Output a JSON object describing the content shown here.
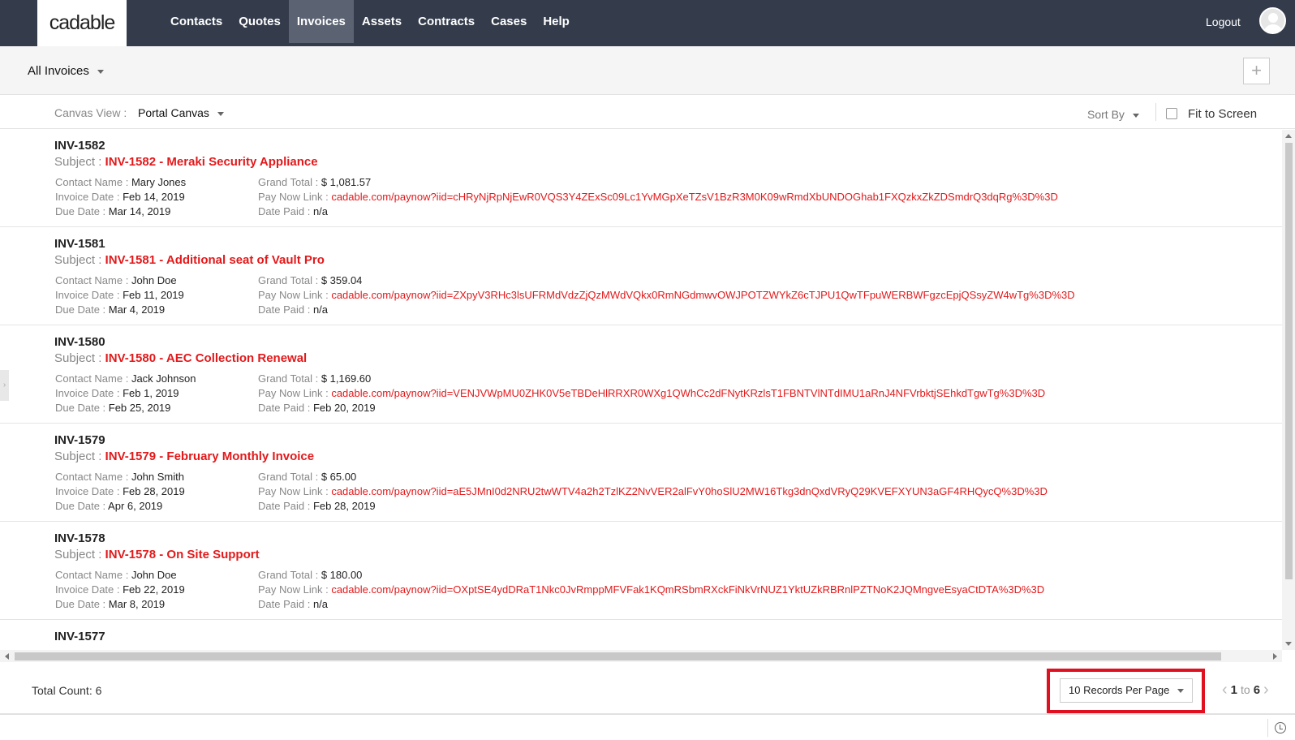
{
  "app": {
    "logo_text": "cadable"
  },
  "nav": {
    "items": [
      {
        "label": "Contacts"
      },
      {
        "label": "Quotes"
      },
      {
        "label": "Invoices"
      },
      {
        "label": "Assets"
      },
      {
        "label": "Contracts"
      },
      {
        "label": "Cases"
      },
      {
        "label": "Help"
      }
    ],
    "active": "Invoices",
    "logout_label": "Logout"
  },
  "header": {
    "view_title": "All Invoices",
    "add_symbol": "+"
  },
  "toolbar": {
    "canvas_view_label": "Canvas View :",
    "canvas_view_value": "Portal Canvas",
    "sort_by_label": "Sort By",
    "fit_to_screen_label": "Fit to Screen",
    "fit_to_screen_checked": false
  },
  "labels": {
    "subject": "Subject : ",
    "contact_name": "Contact Name : ",
    "invoice_date": "Invoice Date : ",
    "due_date": "Due Date : ",
    "grand_total": "Grand Total : ",
    "pay_now_link": "Pay Now Link : ",
    "date_paid": "Date Paid : "
  },
  "invoices": [
    {
      "number": "INV-1582",
      "subject": "INV-1582 - Meraki Security Appliance",
      "contact_name": "Mary Jones",
      "invoice_date": "Feb 14, 2019",
      "due_date": "Mar 14, 2019",
      "grand_total": "$ 1,081.57",
      "pay_now_link": "cadable.com/paynow?iid=cHRyNjRpNjEwR0VQS3Y4ZExSc09Lc1YvMGpXeTZsV1BzR3M0K09wRmdXbUNDOGhab1FXQzkxZkZDSmdrQ3dqRg%3D%3D",
      "date_paid": "n/a"
    },
    {
      "number": "INV-1581",
      "subject": "INV-1581 - Additional seat of Vault Pro",
      "contact_name": "John Doe",
      "invoice_date": "Feb 11, 2019",
      "due_date": "Mar 4, 2019",
      "grand_total": "$ 359.04",
      "pay_now_link": "cadable.com/paynow?iid=ZXpyV3RHc3lsUFRMdVdzZjQzMWdVQkx0RmNGdmwvOWJPOTZWYkZ6cTJPU1QwTFpuWERBWFgzcEpjQSsyZW4wTg%3D%3D",
      "date_paid": "n/a"
    },
    {
      "number": "INV-1580",
      "subject": "INV-1580 - AEC Collection Renewal",
      "contact_name": "Jack Johnson",
      "invoice_date": "Feb 1, 2019",
      "due_date": "Feb 25, 2019",
      "grand_total": "$ 1,169.60",
      "pay_now_link": "cadable.com/paynow?iid=VENJVWpMU0ZHK0V5eTBDeHlRRXR0WXg1QWhCc2dFNytKRzlsT1FBNTVlNTdIMU1aRnJ4NFVrbktjSEhkdTgwTg%3D%3D",
      "date_paid": "Feb 20, 2019"
    },
    {
      "number": "INV-1579",
      "subject": "INV-1579 - February Monthly Invoice",
      "contact_name": "John Smith",
      "invoice_date": "Feb 28, 2019",
      "due_date": "Apr 6, 2019",
      "grand_total": "$ 65.00",
      "pay_now_link": "cadable.com/paynow?iid=aE5JMnI0d2NRU2twWTV4a2h2TzlKZ2NvVER2alFvY0hoSlU2MW16Tkg3dnQxdVRyQ29KVEFXYUN3aGF4RHQycQ%3D%3D",
      "date_paid": "Feb 28, 2019"
    },
    {
      "number": "INV-1578",
      "subject": "INV-1578 - On Site Support",
      "contact_name": "John Doe",
      "invoice_date": "Feb 22, 2019",
      "due_date": "Mar 8, 2019",
      "grand_total": "$ 180.00",
      "pay_now_link": "cadable.com/paynow?iid=OXptSE4ydDRaT1Nkc0JvRmppMFVFak1KQmRSbmRXckFiNkVrNUZ1YktUZkRBRnlPZTNoK2JQMngveEsyaCtDTA%3D%3D",
      "date_paid": "n/a"
    },
    {
      "number": "INV-1577"
    }
  ],
  "footer": {
    "total_count_label": "Total Count: ",
    "total_count": "6",
    "per_page": "10 Records Per Page",
    "page_from": "1",
    "page_to_word": "to",
    "page_to": "6"
  }
}
